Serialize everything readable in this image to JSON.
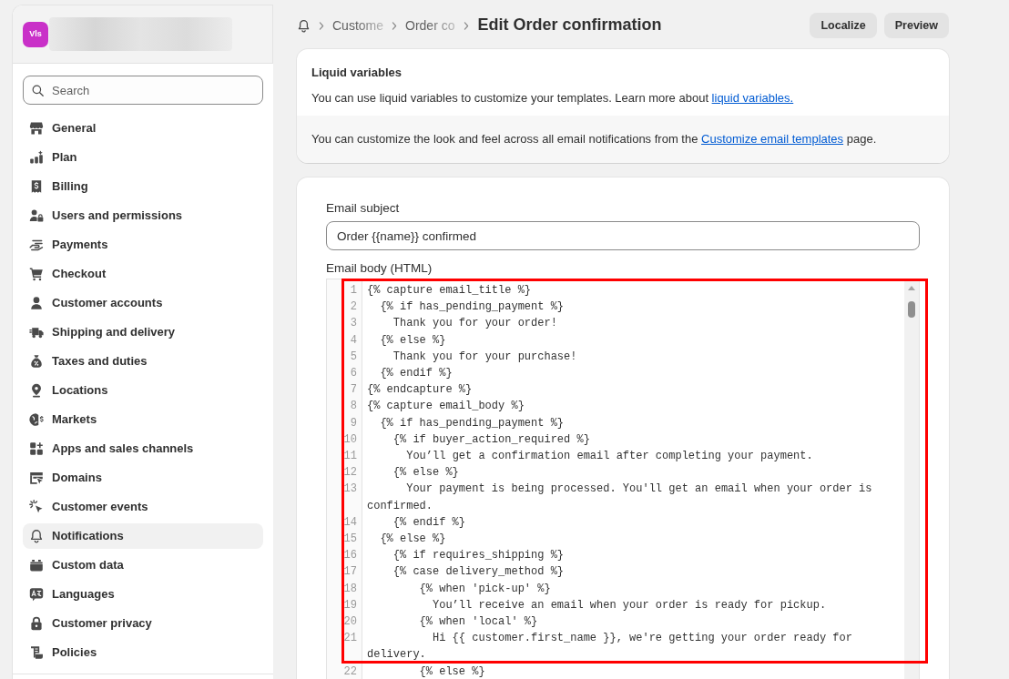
{
  "sidebar": {
    "avatar": {
      "initials": "Vls"
    },
    "search": {
      "placeholder": "Search"
    },
    "items": [
      {
        "label": "General",
        "selected": false
      },
      {
        "label": "Plan",
        "selected": false
      },
      {
        "label": "Billing",
        "selected": false
      },
      {
        "label": "Users and permissions",
        "selected": false
      },
      {
        "label": "Payments",
        "selected": false
      },
      {
        "label": "Checkout",
        "selected": false
      },
      {
        "label": "Customer accounts",
        "selected": false
      },
      {
        "label": "Shipping and delivery",
        "selected": false
      },
      {
        "label": "Taxes and duties",
        "selected": false
      },
      {
        "label": "Locations",
        "selected": false
      },
      {
        "label": "Markets",
        "selected": false
      },
      {
        "label": "Apps and sales channels",
        "selected": false
      },
      {
        "label": "Domains",
        "selected": false
      },
      {
        "label": "Customer events",
        "selected": false
      },
      {
        "label": "Notifications",
        "selected": true
      },
      {
        "label": "Custom data",
        "selected": false
      },
      {
        "label": "Languages",
        "selected": false
      },
      {
        "label": "Customer privacy",
        "selected": false
      },
      {
        "label": "Policies",
        "selected": false
      }
    ]
  },
  "header": {
    "breadcrumbs": [
      "Custome",
      "Order co"
    ],
    "title": "Edit Order confirmation",
    "buttons": [
      "Localize",
      "Preview"
    ]
  },
  "liquid_variables": {
    "title": "Liquid variables",
    "text": "You can use liquid variables to customize your templates. Learn more about",
    "link": "liquid variables.",
    "note": {
      "text_before": "You can customize the look and feel across all email notifications from the",
      "link": "Customize email templates",
      "text_after": "page."
    }
  },
  "email_form": {
    "subject": {
      "label": "Email subject",
      "value": "Order {{name}} confirmed"
    },
    "body": {
      "label": "Email body (HTML)",
      "lines": [
        {
          "number": "1",
          "text": "{% capture email_title %}"
        },
        {
          "number": "2",
          "text": "  {% if has_pending_payment %}"
        },
        {
          "number": "3",
          "text": "    Thank you for your order!"
        },
        {
          "number": "4",
          "text": "  {% else %}"
        },
        {
          "number": "5",
          "text": "    Thank you for your purchase!"
        },
        {
          "number": "6",
          "text": "  {% endif %}"
        },
        {
          "number": "7",
          "text": "{% endcapture %}"
        },
        {
          "number": "8",
          "text": "{% capture email_body %}"
        },
        {
          "number": "9",
          "text": "  {% if has_pending_payment %}"
        },
        {
          "number": "10",
          "text": "    {% if buyer_action_required %}"
        },
        {
          "number": "11",
          "text": "      You’ll get a confirmation email after completing your payment."
        },
        {
          "number": "12",
          "text": "    {% else %}"
        },
        {
          "number": "13",
          "text": "      Your payment is being processed. You'll get an email when your order is confirmed."
        },
        {
          "number": "14",
          "text": "    {% endif %}"
        },
        {
          "number": "15",
          "text": "  {% else %}"
        },
        {
          "number": "16",
          "text": "    {% if requires_shipping %}"
        },
        {
          "number": "17",
          "text": "    {% case delivery_method %}"
        },
        {
          "number": "18",
          "text": "        {% when 'pick-up' %}"
        },
        {
          "number": "19",
          "text": "          You’ll receive an email when your order is ready for pickup."
        },
        {
          "number": "20",
          "text": "        {% when 'local' %}"
        },
        {
          "number": "21",
          "text": "          Hi {{ customer.first_name }}, we're getting your order ready for delivery."
        },
        {
          "number": "22",
          "text": "        {% else %}"
        }
      ]
    }
  }
}
